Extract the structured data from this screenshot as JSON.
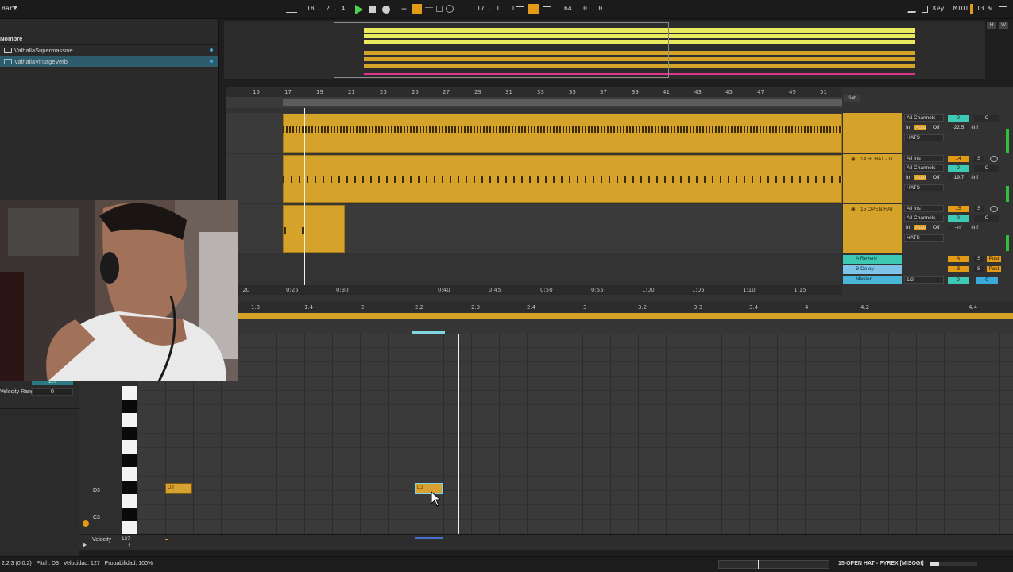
{
  "transport": {
    "menu_label": "Bar",
    "position": "18 . 2 . 4",
    "loop_start": "17 . 1 . 1",
    "loop_length": "64 . 0 . 0",
    "key_label": "Key",
    "midi_label": "MIDI",
    "cpu": "13 %",
    "hw_h": "H",
    "hw_w": "W"
  },
  "browser": {
    "header": "Nombre",
    "items": [
      {
        "label": "ValhallaSupermassive"
      },
      {
        "label": "ValhallaVintageVerb"
      }
    ],
    "velocity_range_label": "Velocity Range",
    "velocity_range_value": "0",
    "velocity_value": "127"
  },
  "arrangement": {
    "set_label": "Set",
    "ruler_bars": [
      "15",
      "17",
      "19",
      "21",
      "23",
      "25",
      "27",
      "29",
      "31",
      "33",
      "35",
      "37",
      "39",
      "41",
      "43",
      "45",
      "47",
      "49",
      "51"
    ],
    "time_ruler": [
      ":20",
      "0:25",
      "0:30",
      "0:40",
      "0:45",
      "0:50",
      "0:55",
      "1:00",
      "1:05",
      "1:10",
      "1:15"
    ],
    "tracks": [
      {
        "name": "",
        "input": "All Channels",
        "monitor_in": "In",
        "monitor_auto": "Auto",
        "monitor_off": "Off",
        "output": "HATS",
        "volume": "0",
        "pan": "C",
        "db": "-22.5",
        "db2": "-inf"
      },
      {
        "name": "14 HI HAT - D",
        "input": "All Ins",
        "channel": "All Channels",
        "monitor_in": "In",
        "monitor_auto": "Auto",
        "monitor_off": "Off",
        "output": "HATS",
        "number": "14",
        "volume": "0",
        "pan": "C",
        "db": "-19.7",
        "db2": "-inf"
      },
      {
        "name": "15 OPEN HAT",
        "input": "All Ins",
        "channel": "All Channels",
        "monitor_in": "In",
        "monitor_auto": "Auto",
        "monitor_off": "Off",
        "output": "HATS",
        "number": "15",
        "volume": "0",
        "pan": "C",
        "db": "-inf",
        "db2": "-inf"
      }
    ],
    "returns": [
      {
        "name": "A Reverb",
        "value": "A",
        "post": "Post",
        "color": "#3ec9b4"
      },
      {
        "name": "B Delay",
        "value": "B",
        "post": "Post",
        "color": "#7fc4e8"
      },
      {
        "name": "Master",
        "value": "1/2",
        "volume": "0",
        "vol2": "0",
        "color": "#49b6d9"
      }
    ],
    "s_label": "S"
  },
  "editor": {
    "ruler": [
      "1.3",
      "1.4",
      "2",
      "2.2",
      "2.3",
      "2.4",
      "3",
      "3.2",
      "3.3",
      "3.4",
      "4",
      "4.2",
      "4.4"
    ],
    "notes": [
      {
        "label": "D3"
      },
      {
        "label": "D3"
      }
    ],
    "key_labels": {
      "d3": "D3",
      "c3": "C3"
    },
    "velocity_label": "Velocity",
    "velocity_max": "127",
    "velocity_min": "1"
  },
  "status": {
    "left": "2.2.3 (0.0.2)   Pitch: D3   Velocidad: 127   Probabilidad: 100%",
    "right": "15-OPEN HAT - PYREX [MISOGI]"
  }
}
